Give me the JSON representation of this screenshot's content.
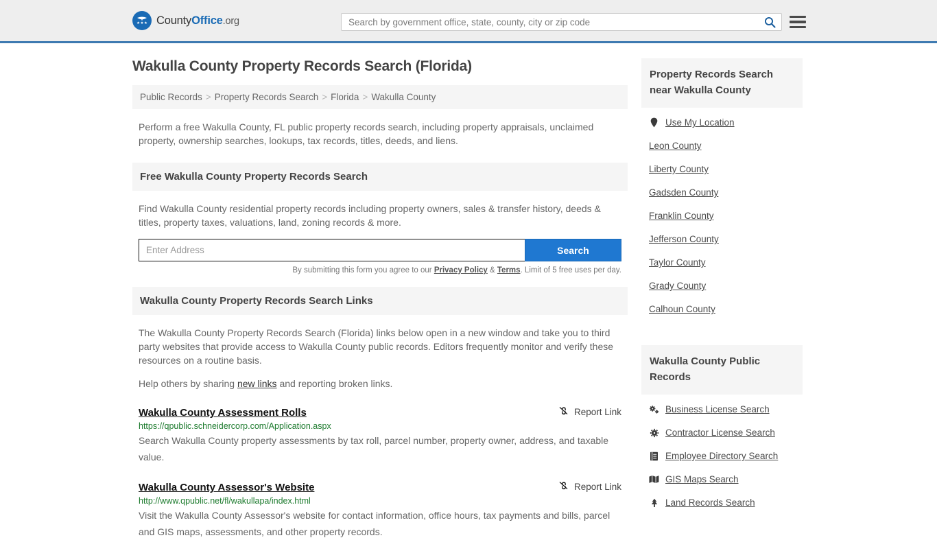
{
  "header": {
    "logo": {
      "part1": "County",
      "part2": "Office",
      "part3": ".org",
      "icon": "eagle-stars-seal-icon"
    },
    "search": {
      "placeholder": "Search by government office, state, county, city or zip code",
      "value": "",
      "icon": "search-icon"
    },
    "menu_icon": "hamburger-menu-icon"
  },
  "main": {
    "title": "Wakulla County Property Records Search (Florida)",
    "breadcrumb": [
      {
        "label": "Public Records"
      },
      {
        "label": "Property Records Search"
      },
      {
        "label": "Florida"
      },
      {
        "label": "Wakulla County"
      }
    ],
    "breadcrumb_separator": ">",
    "intro": "Perform a free Wakulla County, FL public property records search, including property appraisals, unclaimed property, ownership searches, lookups, tax records, titles, deeds, and liens.",
    "free_search": {
      "heading": "Free Wakulla County Property Records Search",
      "description": "Find Wakulla County residential property records including property owners, sales & transfer history, deeds & titles, property taxes, valuations, land, zoning records & more.",
      "input_placeholder": "Enter Address",
      "input_value": "",
      "button_label": "Search",
      "disclaimer_before": "By submitting this form you agree to our ",
      "disclaimer_privacy": "Privacy Policy",
      "disclaimer_amp": " & ",
      "disclaimer_terms": "Terms",
      "disclaimer_after": ". Limit of 5 free uses per day."
    },
    "links_section": {
      "heading": "Wakulla County Property Records Search Links",
      "paragraph": "The Wakulla County Property Records Search (Florida) links below open in a new window and take you to third party websites that provide access to Wakulla County public records. Editors frequently monitor and verify these resources on a routine basis.",
      "help_before": "Help others by sharing ",
      "help_link": "new links",
      "help_after": " and reporting broken links."
    },
    "results": [
      {
        "title": "Wakulla County Assessment Rolls",
        "url": "https://qpublic.schneidercorp.com/Application.aspx",
        "description": "Search Wakulla County property assessments by tax roll, parcel number, property owner, address, and taxable value.",
        "report_label": "Report Link",
        "report_icon": "broken-link-icon"
      },
      {
        "title": "Wakulla County Assessor's Website",
        "url": "http://www.qpublic.net/fl/wakullapa/index.html",
        "description": "Visit the Wakulla County Assessor's website for contact information, office hours, tax payments and bills, parcel and GIS maps, assessments, and other property records.",
        "report_label": "Report Link",
        "report_icon": "broken-link-icon"
      }
    ]
  },
  "sidebar": {
    "nearby": {
      "heading": "Property Records Search near Wakulla County",
      "items": [
        {
          "label": "Use My Location",
          "icon": "map-pin-icon"
        },
        {
          "label": "Leon County",
          "icon": ""
        },
        {
          "label": "Liberty County",
          "icon": ""
        },
        {
          "label": "Gadsden County",
          "icon": ""
        },
        {
          "label": "Franklin County",
          "icon": ""
        },
        {
          "label": "Jefferson County",
          "icon": ""
        },
        {
          "label": "Taylor County",
          "icon": ""
        },
        {
          "label": "Grady County",
          "icon": ""
        },
        {
          "label": "Calhoun County",
          "icon": ""
        }
      ]
    },
    "public_records": {
      "heading": "Wakulla County Public Records",
      "items": [
        {
          "label": "Business License Search",
          "icon": "cogs-icon"
        },
        {
          "label": "Contractor License Search",
          "icon": "gear-icon"
        },
        {
          "label": "Employee Directory Search",
          "icon": "book-icon"
        },
        {
          "label": "GIS Maps Search",
          "icon": "map-icon"
        },
        {
          "label": "Land Records Search",
          "icon": "tree-icon"
        }
      ]
    }
  },
  "colors": {
    "brand_blue": "#1a6bb5",
    "header_border": "#3d7ab1",
    "button_blue": "#1f78d1",
    "url_green": "#1d7b2e",
    "panel_gray": "#f5f5f5"
  }
}
